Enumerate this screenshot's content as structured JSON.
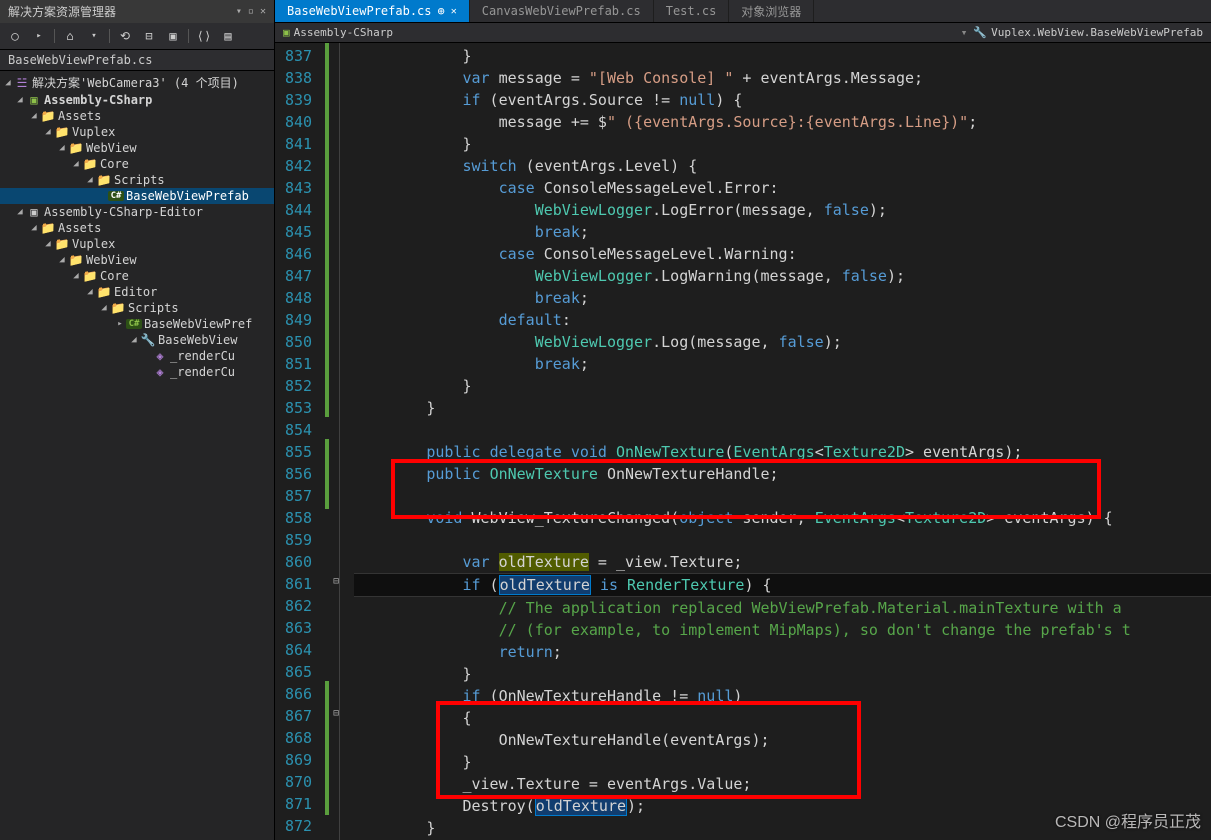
{
  "panelTitle": "解决方案资源管理器",
  "fileLabel": "BaseWebViewPrefab.cs",
  "solutionLine": "解决方案'WebCamera3' (4 个项目)",
  "tree": {
    "proj1": "Assembly-CSharp",
    "assets1": "Assets",
    "vuplex1": "Vuplex",
    "webview1": "WebView",
    "core1": "Core",
    "scripts1": "Scripts",
    "file1": "BaseWebViewPrefab",
    "proj2": "Assembly-CSharp-Editor",
    "assets2": "Assets",
    "vuplex2": "Vuplex",
    "webview2": "WebView",
    "core2": "Core",
    "editor2": "Editor",
    "scripts2": "Scripts",
    "file2a": "BaseWebViewPref",
    "file2b": "BaseWebView",
    "member1": "_renderCu",
    "member2": "_renderCu"
  },
  "tabs": [
    {
      "label": "BaseWebViewPrefab.cs",
      "active": true
    },
    {
      "label": "CanvasWebViewPrefab.cs",
      "active": false
    },
    {
      "label": "Test.cs",
      "active": false
    },
    {
      "label": "对象浏览器",
      "active": false
    }
  ],
  "breadcrumb": {
    "left": "Assembly-CSharp",
    "right": "Vuplex.WebView.BaseWebViewPrefab"
  },
  "lineStart": 837,
  "lineEnd": 872,
  "code": {
    "l837": "            }",
    "l838": {
      "a": "            ",
      "k": "var",
      "b": " message = ",
      "s": "\"[Web Console] \"",
      "c": " + eventArgs.Message;"
    },
    "l839": {
      "a": "            ",
      "k": "if",
      "b": " (eventArgs.Source != ",
      "k2": "null",
      "c": ") {"
    },
    "l840": {
      "a": "                message += $",
      "s": "\" ({eventArgs.Source}:{eventArgs.Line})\"",
      "b": ";"
    },
    "l841": "            }",
    "l842": {
      "a": "            ",
      "k": "switch",
      "b": " (eventArgs.Level) {"
    },
    "l843": {
      "a": "                ",
      "k": "case",
      "b": " ConsoleMessageLevel.Error:"
    },
    "l844": {
      "a": "                    ",
      "t": "WebViewLogger",
      "b": ".LogError(message, ",
      "k": "false",
      "c": ");"
    },
    "l845": {
      "a": "                    ",
      "k": "break",
      "b": ";"
    },
    "l846": {
      "a": "                ",
      "k": "case",
      "b": " ConsoleMessageLevel.Warning:"
    },
    "l847": {
      "a": "                    ",
      "t": "WebViewLogger",
      "b": ".LogWarning(message, ",
      "k": "false",
      "c": ");"
    },
    "l848": {
      "a": "                    ",
      "k": "break",
      "b": ";"
    },
    "l849": {
      "a": "                ",
      "k": "default",
      "b": ":"
    },
    "l850": {
      "a": "                    ",
      "t": "WebViewLogger",
      "b": ".Log(message, ",
      "k": "false",
      "c": ");"
    },
    "l851": {
      "a": "                    ",
      "k": "break",
      "b": ";"
    },
    "l852": "            }",
    "l853": "        }",
    "l854": "",
    "l855": {
      "a": "        ",
      "k1": "public",
      "sp1": " ",
      "k2": "delegate",
      "sp2": " ",
      "k3": "void",
      "sp3": " ",
      "m": "OnNewTexture",
      "b": "(",
      "t1": "EventArgs",
      "lt": "<",
      "t2": "Texture2D",
      "gt": ">",
      "c": " eventArgs);"
    },
    "l856": {
      "a": "        ",
      "k": "public",
      "sp": " ",
      "t": "OnNewTexture",
      "b": " OnNewTextureHandle;"
    },
    "l857": "",
    "l858": {
      "a": "        ",
      "k": "void",
      "b": " WebView_TextureChanged(",
      "k2": "object",
      "c": " sender, ",
      "t1": "EventArgs",
      "lt": "<",
      "t2": "Texture2D",
      "gt": ">",
      "d": " eventArgs) {"
    },
    "l859": "",
    "l860": {
      "a": "            ",
      "k": "var",
      "sp": " ",
      "h": "oldTexture",
      "b": " = _view.Texture;"
    },
    "l861": {
      "a": "            ",
      "k": "if",
      "b": " (",
      "h": "oldTexture",
      "sp": " ",
      "k2": "is",
      "sp2": " ",
      "t": "RenderTexture",
      "c": ") {"
    },
    "l862": {
      "a": "                ",
      "c": "// The application replaced WebViewPrefab.Material.mainTexture with a "
    },
    "l863": {
      "a": "                ",
      "c": "// (for example, to implement MipMaps), so don't change the prefab's t"
    },
    "l864": {
      "a": "                ",
      "k": "return",
      "b": ";"
    },
    "l865": "            }",
    "l866": {
      "a": "            ",
      "k": "if",
      "b": " (OnNewTextureHandle != ",
      "k2": "null",
      "c": ")"
    },
    "l867": "            {",
    "l868": "                OnNewTextureHandle(eventArgs);",
    "l869": "            }",
    "l870": "            _view.Texture = eventArgs.Value;",
    "l871": {
      "a": "            Destroy(",
      "h": "oldTexture",
      "b": ");"
    },
    "l872": "        }"
  },
  "watermark": "CSDN @程序员正茂"
}
